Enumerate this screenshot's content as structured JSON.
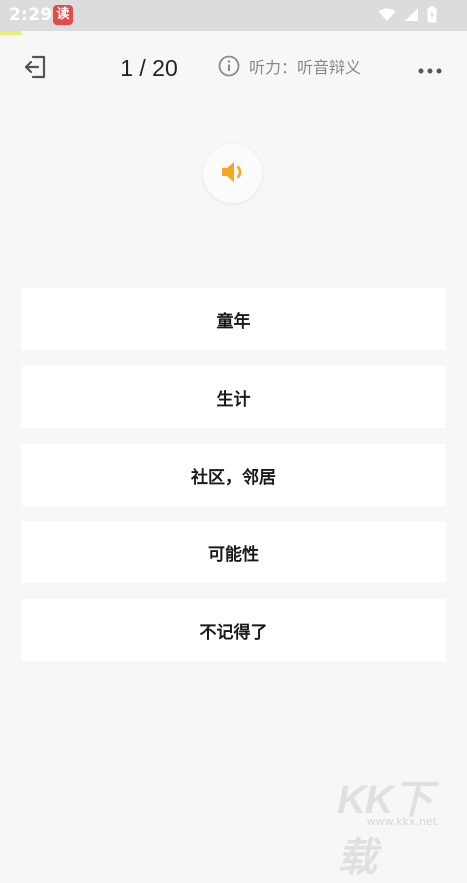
{
  "status_bar": {
    "time": "2:29",
    "app_badge": "读",
    "icons": [
      "wifi-icon",
      "signal-icon",
      "battery-icon"
    ]
  },
  "header": {
    "counter": "1 / 20",
    "mode_label": "听力：听音辩义",
    "icons": {
      "exit": "exit-icon",
      "info": "info-icon",
      "more": "more-icon"
    }
  },
  "audio": {
    "icon": "speaker-icon",
    "accent": "#f6a623"
  },
  "options": [
    {
      "label": "童年"
    },
    {
      "label": "生计"
    },
    {
      "label": "社区，邻居"
    },
    {
      "label": "可能性"
    },
    {
      "label": "不记得了"
    }
  ],
  "watermark": {
    "logo": "KK下载",
    "url": "www.kkx.net"
  },
  "colors": {
    "background": "#f7f7f7",
    "card": "#ffffff",
    "status_bar": "#dcdcdc",
    "text_primary": "#1a1a1a",
    "text_secondary": "#888888",
    "accent_audio": "#f6a623"
  }
}
